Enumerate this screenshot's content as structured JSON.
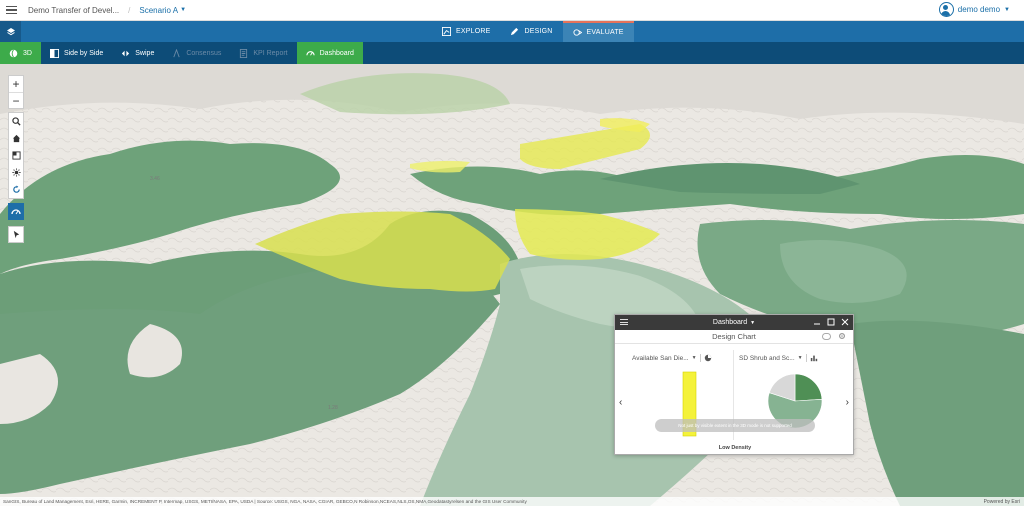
{
  "topbar": {
    "project_title": "Demo Transfer of Devel...",
    "separator": "/",
    "scenario": "Scenario A",
    "user": "demo demo"
  },
  "mainnav": {
    "tabs": [
      {
        "label": "EXPLORE",
        "icon": "explore-icon"
      },
      {
        "label": "DESIGN",
        "icon": "pencil-icon"
      },
      {
        "label": "EVALUATE",
        "icon": "evaluate-icon",
        "active": true
      }
    ]
  },
  "subbar": {
    "tools": [
      {
        "label": "3D",
        "icon": "globe-icon",
        "state": "active"
      },
      {
        "label": "Side by Side",
        "icon": "split-view-icon",
        "state": "normal"
      },
      {
        "label": "Swipe",
        "icon": "swipe-icon",
        "state": "normal"
      },
      {
        "label": "Consensus",
        "icon": "consensus-icon",
        "state": "disabled"
      },
      {
        "label": "KPI Report",
        "icon": "report-icon",
        "state": "disabled"
      },
      {
        "label": "Dashboard",
        "icon": "dashboard-icon",
        "state": "active"
      }
    ]
  },
  "map": {
    "labels": [
      "3.46",
      "1.28"
    ],
    "attribution": "SanGIS, Bureau of Land Management, Esri, HERE, Garmin, INCREMENT P, Intermap, USGS, METI/NASA, EPA, USDA | Source: USGS, NGA, NASA, CGIAR, GEBCO,N Robinson,NCEAS,NLS,OS,NMA,Geodatastyrelsen and the GIS User Community",
    "powered_by": "Powered by Esri"
  },
  "dashboard": {
    "title": "Dashboard",
    "chart_title": "Design Chart",
    "left_selector": "Available San Die...",
    "right_selector": "SD Shrub and Sc...",
    "tooltip": "Not just by visible extent in the 3D mode is not supported",
    "legend_label": "Low Density",
    "colors": {
      "bar": "#f4f23a",
      "pie_dark": "#4f8f55",
      "pie_mid": "#86b392",
      "pie_light": "#d8d8d8"
    }
  },
  "chart_data": [
    {
      "type": "bar",
      "categories": [
        "Low Density"
      ],
      "values": [
        1
      ],
      "ylim": [
        0,
        1
      ]
    },
    {
      "type": "pie",
      "categories": [
        "Low Density",
        "",
        ""
      ],
      "values": [
        0.24,
        0.56,
        0.2
      ]
    }
  ]
}
